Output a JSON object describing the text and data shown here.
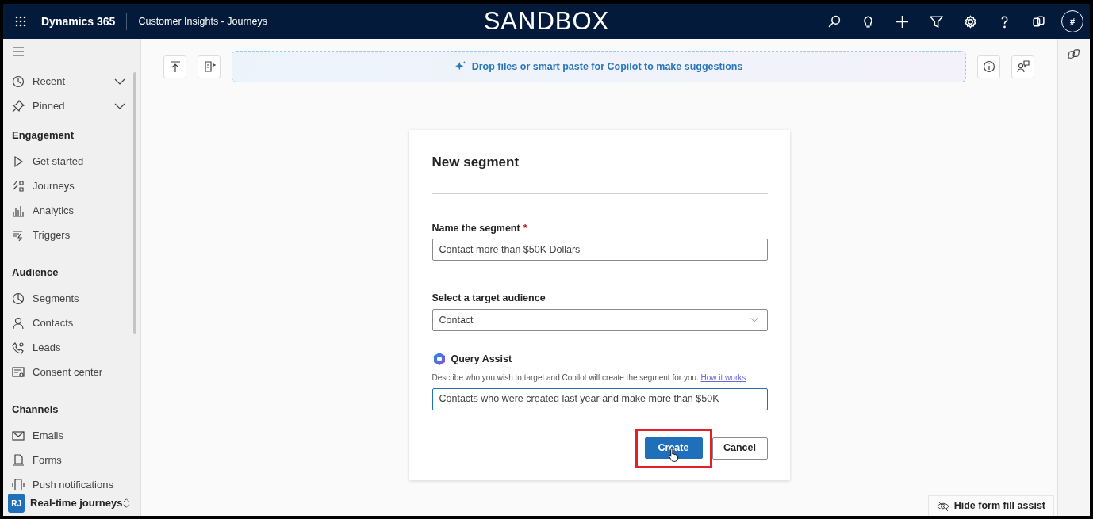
{
  "header": {
    "app_name": "Dynamics 365",
    "app_title": "Customer Insights - Journeys",
    "environment": "SANDBOX",
    "avatar": "#"
  },
  "sidebar": {
    "top_items": [
      {
        "label": "Recent",
        "expanded": false
      },
      {
        "label": "Pinned",
        "expanded": false
      }
    ],
    "groups": [
      {
        "title": "Engagement",
        "items": [
          {
            "label": "Get started"
          },
          {
            "label": "Journeys"
          },
          {
            "label": "Analytics"
          },
          {
            "label": "Triggers"
          }
        ]
      },
      {
        "title": "Audience",
        "items": [
          {
            "label": "Segments"
          },
          {
            "label": "Contacts"
          },
          {
            "label": "Leads"
          },
          {
            "label": "Consent center"
          }
        ]
      },
      {
        "title": "Channels",
        "items": [
          {
            "label": "Emails"
          },
          {
            "label": "Forms"
          },
          {
            "label": "Push notifications"
          }
        ]
      }
    ],
    "footer": {
      "badge": "RJ",
      "label": "Real-time journeys"
    }
  },
  "toolbar": {
    "copilot_prompt": "Drop files or smart paste for Copilot to make suggestions"
  },
  "form": {
    "title": "New segment",
    "required_mark": "*",
    "fields": [
      {
        "kind": "text",
        "label": "Name the segment",
        "required": true,
        "value": "Contact more than $50K Dollars"
      },
      {
        "kind": "select",
        "label": "Select a target audience",
        "required": false,
        "value": "Contact"
      }
    ],
    "query_assist": {
      "title": "Query Assist",
      "description": "Describe who you wish to target and Copilot will create the segment for you.",
      "link": "How it works",
      "value": "Contacts who were created last year and make more than $50K",
      "focused": true
    },
    "buttons": [
      {
        "label": "Create",
        "kind": "primary",
        "highlighted": true
      },
      {
        "label": "Cancel",
        "kind": "secondary",
        "highlighted": false
      }
    ]
  },
  "hide_button": {
    "label": "Hide form fill assist"
  }
}
